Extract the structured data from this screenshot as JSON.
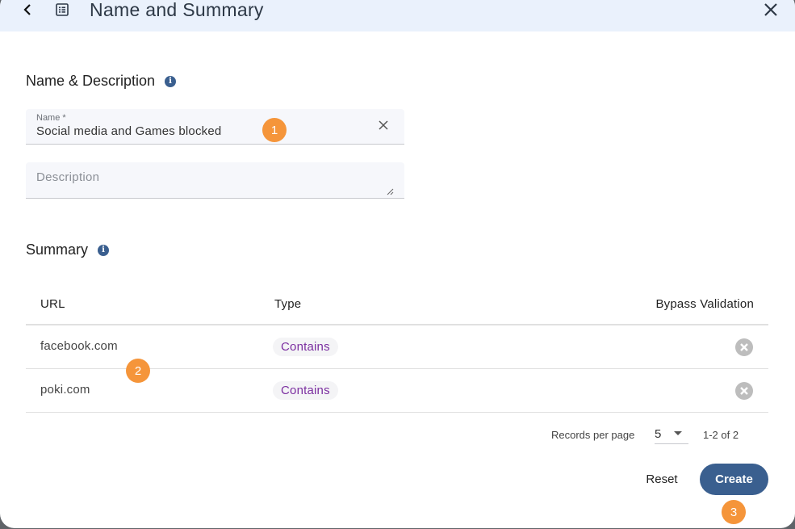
{
  "header": {
    "title": "Name and Summary",
    "back_icon": "chevron-left-icon",
    "list_icon": "list-alt-icon",
    "close_icon": "close-icon"
  },
  "name_section": {
    "title": "Name & Description",
    "info_icon": "i",
    "name_field": {
      "label": "Name *",
      "value": "Social media and Games blocked"
    },
    "description_field": {
      "placeholder": "Description",
      "value": ""
    }
  },
  "summary_section": {
    "title": "Summary",
    "info_icon": "i",
    "columns": [
      "URL",
      "Type",
      "Bypass Validation"
    ],
    "rows": [
      {
        "url": "facebook.com",
        "type": "Contains",
        "bypass_validation": false
      },
      {
        "url": "poki.com",
        "type": "Contains",
        "bypass_validation": false
      }
    ]
  },
  "pagination": {
    "records_per_page_label": "Records per page",
    "records_per_page": "5",
    "range": "1-2 of 2"
  },
  "actions": {
    "reset_label": "Reset",
    "create_label": "Create"
  },
  "step_badges": [
    "1",
    "2",
    "3"
  ],
  "colors": {
    "header_bg": "#eaf1fc",
    "primary": "#3a5f8f",
    "chip_text": "#7b2ea0",
    "badge": "#f5953a"
  }
}
